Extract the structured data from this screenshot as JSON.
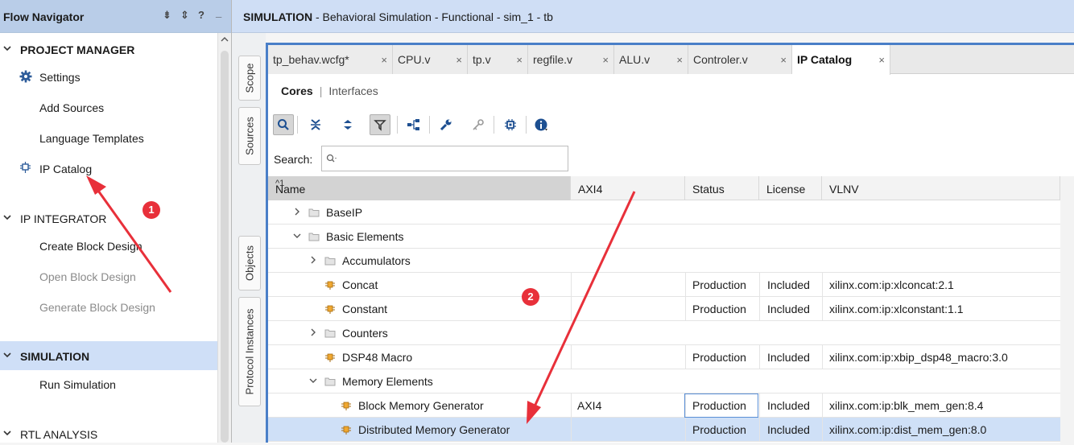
{
  "flow_navigator": {
    "title": "Flow Navigator",
    "controls": [
      "⇟",
      "⇕",
      "?",
      "_"
    ],
    "items": [
      {
        "label": "PROJECT MANAGER",
        "type": "section",
        "expanded": true
      },
      {
        "label": "Settings",
        "icon": "gear-icon"
      },
      {
        "label": "Add Sources"
      },
      {
        "label": "Language Templates"
      },
      {
        "label": "IP Catalog",
        "icon": "ip-chip-icon"
      },
      {
        "label": "IP INTEGRATOR",
        "type": "section",
        "expanded": true
      },
      {
        "label": "Create Block Design"
      },
      {
        "label": "Open Block Design",
        "disabled": true
      },
      {
        "label": "Generate Block Design",
        "disabled": true
      },
      {
        "label": "SIMULATION",
        "type": "section",
        "expanded": true,
        "selected": true
      },
      {
        "label": "Run Simulation"
      },
      {
        "label": "RTL ANALYSIS",
        "type": "section",
        "expanded": true
      }
    ]
  },
  "header": {
    "bold": "SIMULATION",
    "rest": " - Behavioral Simulation - Functional - sim_1 - tb"
  },
  "side_tabs": [
    "Scope",
    "Sources",
    "Objects",
    "Protocol Instances"
  ],
  "editor_tabs": [
    {
      "label": "tp_behav.wcfg*",
      "close": "×"
    },
    {
      "label": "CPU.v",
      "close": "×"
    },
    {
      "label": "tp.v",
      "close": "×"
    },
    {
      "label": "regfile.v",
      "close": "×"
    },
    {
      "label": "ALU.v",
      "close": "×"
    },
    {
      "label": "Controler.v",
      "close": "×"
    },
    {
      "label": "IP Catalog",
      "close": "×",
      "active": true
    }
  ],
  "subtabs": {
    "cores": "Cores",
    "sep": "|",
    "interfaces": "Interfaces"
  },
  "search": {
    "label": "Search:",
    "placeholder": ""
  },
  "table": {
    "columns": [
      "Name",
      "AXI4",
      "Status",
      "License",
      "VLNV"
    ],
    "sort_indicator": "^1",
    "rows": [
      {
        "name": "BaseIP",
        "level": 0,
        "type": "folder",
        "expanded": false,
        "axi4": "",
        "status": "",
        "license": "",
        "vlnv": ""
      },
      {
        "name": "Basic Elements",
        "level": 0,
        "type": "folder",
        "expanded": true,
        "axi4": "",
        "status": "",
        "license": "",
        "vlnv": ""
      },
      {
        "name": "Accumulators",
        "level": 1,
        "type": "folder",
        "expanded": false,
        "axi4": "",
        "status": "",
        "license": "",
        "vlnv": ""
      },
      {
        "name": "Concat",
        "level": 1,
        "type": "ip",
        "axi4": "",
        "status": "Production",
        "license": "Included",
        "vlnv": "xilinx.com:ip:xlconcat:2.1"
      },
      {
        "name": "Constant",
        "level": 1,
        "type": "ip",
        "axi4": "",
        "status": "Production",
        "license": "Included",
        "vlnv": "xilinx.com:ip:xlconstant:1.1"
      },
      {
        "name": "Counters",
        "level": 1,
        "type": "folder",
        "expanded": false,
        "axi4": "",
        "status": "",
        "license": "",
        "vlnv": ""
      },
      {
        "name": "DSP48 Macro",
        "level": 1,
        "type": "ip",
        "axi4": "",
        "status": "Production",
        "license": "Included",
        "vlnv": "xilinx.com:ip:xbip_dsp48_macro:3.0"
      },
      {
        "name": "Memory Elements",
        "level": 1,
        "type": "folder",
        "expanded": true,
        "axi4": "",
        "status": "",
        "license": "",
        "vlnv": ""
      },
      {
        "name": "Block Memory Generator",
        "level": 2,
        "type": "ip",
        "axi4": "AXI4",
        "status": "Production",
        "license": "Included",
        "vlnv": "xilinx.com:ip:blk_mem_gen:8.4",
        "focused_cell": "status"
      },
      {
        "name": "Distributed Memory Generator",
        "level": 2,
        "type": "ip",
        "axi4": "",
        "status": "Production",
        "license": "Included",
        "vlnv": "xilinx.com:ip:dist_mem_gen:8.0",
        "selected": true
      }
    ]
  },
  "annotations": {
    "badge1": "1",
    "badge2": "2",
    "color": "#e8303a"
  }
}
